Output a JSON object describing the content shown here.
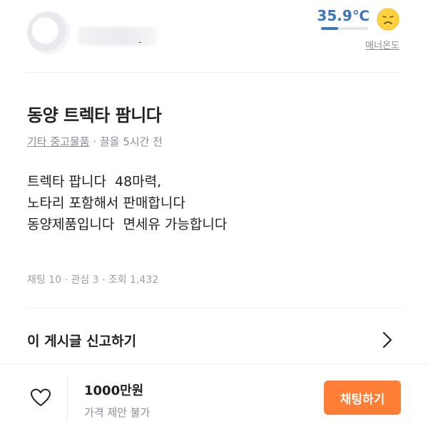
{
  "seller": {
    "manner_temp": "35.9℃",
    "manner_label": "매너온도",
    "manner_progress": 0.36,
    "face_icon": "sad-face-icon"
  },
  "post": {
    "title": "동양 트렉타 팜니다",
    "category": "기타 중고물품",
    "time": " · 끌올 5시간 전",
    "body": "트렉타 팝니다  48마력,\n노타리 포함해서 판매합니다\n동양제품입니다  면세유 가능합니다",
    "stats": "채팅 10 · 관심 3 · 조회 1,432"
  },
  "report": {
    "label": "이 게시글 신고하기",
    "icon": "chevron-right-icon"
  },
  "bottom": {
    "price": "1000만원",
    "negotiation": "가격 제안 불가",
    "chat_button": "채팅하기",
    "like_icon": "heart-icon"
  },
  "colors": {
    "accent": "#ff7e36",
    "temperature": "#3f74b6"
  }
}
